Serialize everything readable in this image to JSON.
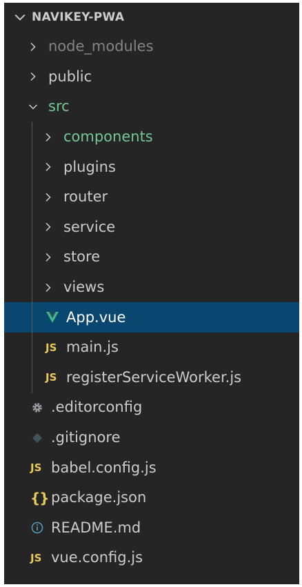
{
  "explorer": {
    "title": "NAVIKEY-PWA",
    "items": [
      {
        "label": "node_modules",
        "type": "folder",
        "expanded": false,
        "depth": 1,
        "icon": "chevron-right-icon",
        "color": "#858585"
      },
      {
        "label": "public",
        "type": "folder",
        "expanded": false,
        "depth": 1,
        "icon": "chevron-right-icon",
        "color": "#cccccc"
      },
      {
        "label": "src",
        "type": "folder",
        "expanded": true,
        "depth": 1,
        "icon": "chevron-down-icon",
        "color": "#73c991"
      },
      {
        "label": "components",
        "type": "folder",
        "expanded": false,
        "depth": 2,
        "icon": "chevron-right-icon",
        "color": "#73c991"
      },
      {
        "label": "plugins",
        "type": "folder",
        "expanded": false,
        "depth": 2,
        "icon": "chevron-right-icon",
        "color": "#cccccc"
      },
      {
        "label": "router",
        "type": "folder",
        "expanded": false,
        "depth": 2,
        "icon": "chevron-right-icon",
        "color": "#cccccc"
      },
      {
        "label": "service",
        "type": "folder",
        "expanded": false,
        "depth": 2,
        "icon": "chevron-right-icon",
        "color": "#cccccc"
      },
      {
        "label": "store",
        "type": "folder",
        "expanded": false,
        "depth": 2,
        "icon": "chevron-right-icon",
        "color": "#cccccc"
      },
      {
        "label": "views",
        "type": "folder",
        "expanded": false,
        "depth": 2,
        "icon": "chevron-right-icon",
        "color": "#cccccc"
      },
      {
        "label": "App.vue",
        "type": "file",
        "depth": 2,
        "icon": "vue-icon",
        "selected": true,
        "color": "#ffffff"
      },
      {
        "label": "main.js",
        "type": "file",
        "depth": 2,
        "icon": "js-icon",
        "icon_text": "JS",
        "color": "#cccccc"
      },
      {
        "label": "registerServiceWorker.js",
        "type": "file",
        "depth": 2,
        "icon": "js-icon",
        "icon_text": "JS",
        "color": "#cccccc"
      },
      {
        "label": ".editorconfig",
        "type": "file",
        "depth": 1,
        "icon": "gear-icon",
        "color": "#cccccc"
      },
      {
        "label": ".gitignore",
        "type": "file",
        "depth": 1,
        "icon": "git-icon",
        "color": "#cccccc"
      },
      {
        "label": "babel.config.js",
        "type": "file",
        "depth": 1,
        "icon": "js-icon",
        "icon_text": "JS",
        "color": "#cccccc"
      },
      {
        "label": "package.json",
        "type": "file",
        "depth": 1,
        "icon": "json-icon",
        "icon_text": "{}",
        "color": "#cccccc"
      },
      {
        "label": "README.md",
        "type": "file",
        "depth": 1,
        "icon": "info-icon",
        "color": "#cccccc"
      },
      {
        "label": "vue.config.js",
        "type": "file",
        "depth": 1,
        "icon": "js-icon",
        "icon_text": "JS",
        "color": "#cccccc"
      }
    ]
  },
  "colors": {
    "background": "#252526",
    "selection": "#094771",
    "js": "#e8c95b",
    "vue": "#41b883",
    "info": "#519aba",
    "muted": "#858585",
    "git_status_added": "#73c991"
  }
}
